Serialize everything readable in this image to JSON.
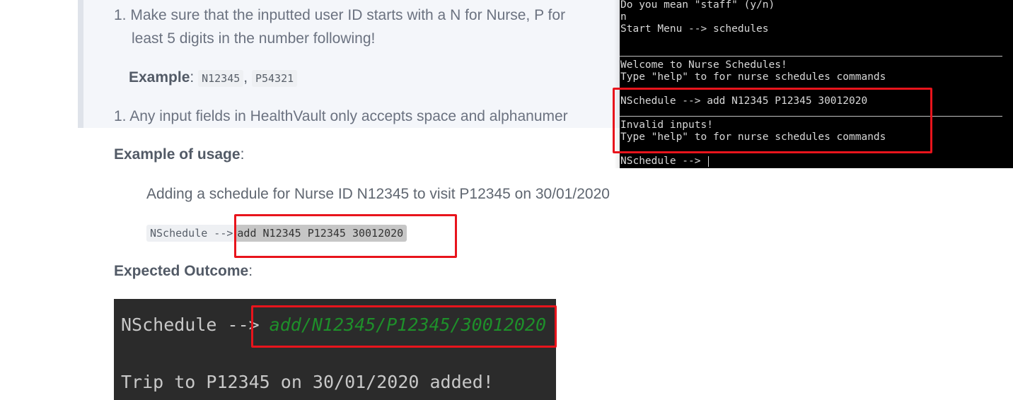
{
  "doc": {
    "item1_line1": "1. Make sure that the inputted user ID starts with a N for Nurse, P for",
    "item1_line2": "least 5 digits in the number following!",
    "example_label": "Example",
    "example_sep": ":",
    "example_code1": "N12345",
    "example_comma": ",",
    "example_code2": "P54321",
    "item2": "1. Any input fields in HealthVault only accepts space and alphanumer",
    "usage_heading": "Example of usage",
    "usage_colon": ":",
    "usage_desc": "Adding a schedule for Nurse ID N12345 to visit P12345 on 30/01/2020",
    "usage_prompt": "NSchedule -->",
    "usage_command": "add N12345 P12345 30012020",
    "outcome_heading": "Expected Outcome",
    "outcome_colon": ":"
  },
  "terminal": {
    "line1": "Do you mean \"staff\" (y/n)",
    "line2": "n",
    "line3": "Start Menu --> schedules",
    "line4": "Welcome to Nurse Schedules!",
    "line5": "Type \"help\" to for nurse schedules commands",
    "line6": "NSchedule --> add N12345 P12345 30012020",
    "line7": "Invalid inputs!",
    "line8": "Type \"help\" to for nurse schedules commands",
    "line9": "NSchedule --> "
  },
  "ide": {
    "prompt": "NSchedule -->",
    "command": "add/N12345/P12345/30012020",
    "result": "Trip to P12345 on 30/01/2020 added!"
  },
  "colors": {
    "highlight_red": "#e8141c",
    "ide_bg": "#2b2b2b",
    "ide_green": "#1e8f2a",
    "terminal_bg": "#000000"
  }
}
